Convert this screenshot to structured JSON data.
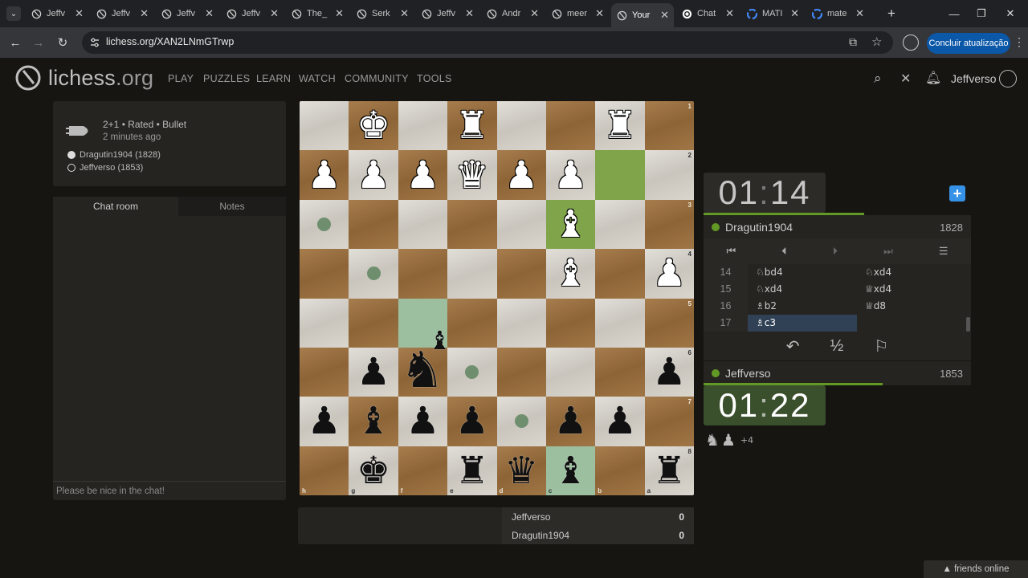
{
  "browser": {
    "tabs": [
      {
        "title": "Jeffv",
        "icon": "lichess-icon"
      },
      {
        "title": "Jeffv",
        "icon": "lichess-icon"
      },
      {
        "title": "Jeffv",
        "icon": "lichess-icon"
      },
      {
        "title": "Jeffv",
        "icon": "lichess-icon"
      },
      {
        "title": "The_",
        "icon": "lichess-icon"
      },
      {
        "title": "Serk",
        "icon": "lichess-icon"
      },
      {
        "title": "Jeffv",
        "icon": "lichess-icon"
      },
      {
        "title": "Andr",
        "icon": "lichess-icon"
      },
      {
        "title": "meer",
        "icon": "lichess-icon"
      },
      {
        "title": "Your",
        "icon": "lichess-icon",
        "active": true
      },
      {
        "title": "Chat",
        "icon": "chatgpt-icon"
      },
      {
        "title": "MATI",
        "icon": "google-icon"
      },
      {
        "title": "mate",
        "icon": "google-icon"
      }
    ],
    "url": "lichess.org/XAN2LNmGTrwp",
    "update_button": "Concluir atualização"
  },
  "header": {
    "logo_name": "lichess",
    "logo_domain": ".org",
    "nav": [
      "PLAY",
      "PUZZLES",
      "LEARN",
      "WATCH",
      "COMMUNITY",
      "TOOLS"
    ],
    "username": "Jeffverso"
  },
  "game_meta": {
    "line1": "2+1 • Rated • Bullet",
    "line2": "2 minutes ago",
    "player_white": "Dragutin1904 (1828)",
    "player_black": "Jeffverso (1853)"
  },
  "chat": {
    "tab_chat": "Chat room",
    "tab_notes": "Notes",
    "placeholder": "Please be nice in the chat!"
  },
  "board": {
    "ranks": [
      "1",
      "2",
      "3",
      "4",
      "5",
      "6",
      "7",
      "8"
    ],
    "files": [
      "h",
      "g",
      "f",
      "e",
      "d",
      "c",
      "b",
      "a"
    ],
    "squares": [
      [
        "",
        "wK",
        "",
        "wR",
        "",
        "",
        "wR",
        ""
      ],
      [
        "wP",
        "wP",
        "wP",
        "wQ",
        "wP",
        "wP",
        "",
        ""
      ],
      [
        "",
        "",
        "",
        "",
        "",
        "wB",
        "",
        ""
      ],
      [
        "",
        "",
        "",
        "",
        "",
        "wB",
        "",
        "wP"
      ],
      [
        "",
        "",
        "",
        "",
        "",
        "",
        "",
        ""
      ],
      [
        "",
        "bP",
        "",
        "",
        "",
        "",
        "",
        "bP"
      ],
      [
        "bP",
        "bB",
        "bP",
        "bP",
        "",
        "bP",
        "bP",
        ""
      ],
      [
        "",
        "bK",
        "",
        "bR",
        "bQ",
        "bB",
        "",
        "bR"
      ]
    ],
    "highlights": [
      [
        1,
        6
      ],
      [
        2,
        5
      ]
    ],
    "green_squares": [
      [
        4,
        2
      ],
      [
        7,
        5
      ]
    ],
    "move_dots": [
      [
        2,
        0
      ],
      [
        3,
        1
      ],
      [
        5,
        3
      ],
      [
        6,
        4
      ]
    ],
    "dragged_pieces": [
      "bN",
      "bB"
    ]
  },
  "clocks": {
    "top": {
      "min": "01",
      "sec": "14"
    },
    "bottom": {
      "min": "01",
      "sec": "22"
    },
    "top_bar_fraction": 0.6,
    "bottom_bar_fraction": 0.67
  },
  "players": {
    "top": {
      "name": "Dragutin1904",
      "rating": "1828"
    },
    "bottom": {
      "name": "Jeffverso",
      "rating": "1853"
    }
  },
  "moves": [
    {
      "num": "14",
      "white": "♘bd4",
      "black": "♘xd4"
    },
    {
      "num": "15",
      "white": "♘xd4",
      "black": "♕xd4"
    },
    {
      "num": "16",
      "white": "♗b2",
      "black": "♕d8"
    },
    {
      "num": "17",
      "white": "♗c3",
      "black": "",
      "active": true
    }
  ],
  "controls": {
    "takeback": "↶",
    "draw": "½",
    "resign": "⚐"
  },
  "material": {
    "pieces": [
      "♞",
      "♟"
    ],
    "count": "+4"
  },
  "crosstable": [
    {
      "name": "Jeffverso",
      "score": "0"
    },
    {
      "name": "Dragutin1904",
      "score": "0"
    }
  ],
  "footer": {
    "friends": "▲ friends online"
  },
  "colors": {
    "accent_green": "#629924",
    "accent_blue": "#3692e7",
    "update_blue": "#0b57a8"
  }
}
